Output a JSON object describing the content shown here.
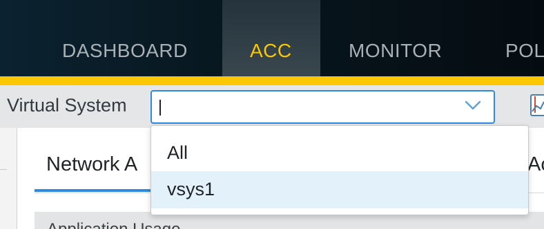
{
  "nav": {
    "tabs": [
      {
        "label": "DASHBOARD",
        "active": false
      },
      {
        "label": "ACC",
        "active": true
      },
      {
        "label": "MONITOR",
        "active": false
      },
      {
        "label": "POL",
        "active": false
      }
    ]
  },
  "filter": {
    "label": "Virtual System",
    "value": "",
    "icon": "chevron-down-icon"
  },
  "dropdown": {
    "options": [
      {
        "label": "All",
        "highlighted": false
      },
      {
        "label": "vsys1",
        "highlighted": true
      }
    ]
  },
  "content": {
    "active_tab": "Network A",
    "partial_tab": "Ac",
    "section_title": "Application Usage"
  },
  "colors": {
    "accent": "#fac700",
    "focus": "#2c8ae0",
    "nav_bg": "#08161e",
    "option_highlight": "#e3f1fa"
  }
}
